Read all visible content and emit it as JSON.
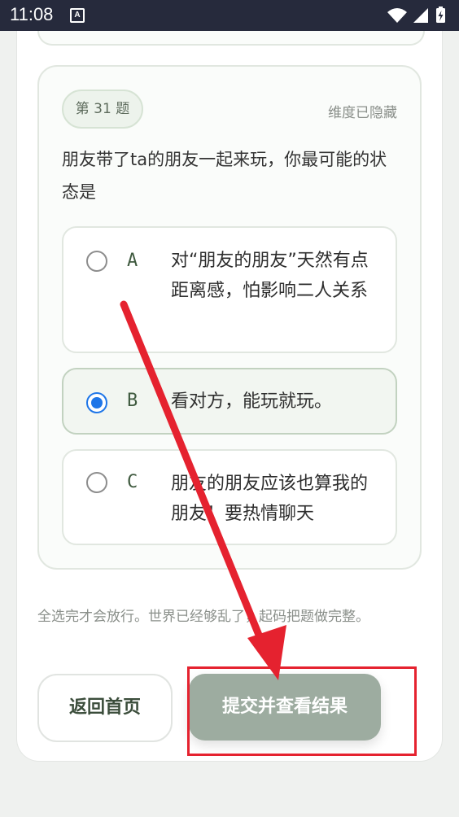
{
  "status_bar": {
    "time": "11:08",
    "notification_badge": "A",
    "icons": [
      "wifi-icon",
      "signal-icon",
      "battery-charging-icon"
    ]
  },
  "question": {
    "number_label": "第 31 题",
    "dimension_status": "维度已隐藏",
    "text": "朋友带了ta的朋友一起来玩，你最可能的状态是",
    "options": [
      {
        "letter": "A",
        "text": "对“朋友的朋友”天然有点距离感，怕影响二人关系",
        "selected": false
      },
      {
        "letter": "B",
        "text": "看对方，能玩就玩。",
        "selected": true
      },
      {
        "letter": "C",
        "text": "朋友的朋友应该也算我的朋友！要热情聊天",
        "selected": false
      }
    ]
  },
  "hint": "全选完才会放行。世界已经够乱了，起码把题做完整。",
  "buttons": {
    "home_label": "返回首页",
    "submit_label": "提交并查看结果"
  },
  "colors": {
    "accent_radio": "#1f76e8",
    "submit_bg": "#9daca0",
    "annotation_red": "#e5222f",
    "status_bar_bg": "#262a3c"
  }
}
